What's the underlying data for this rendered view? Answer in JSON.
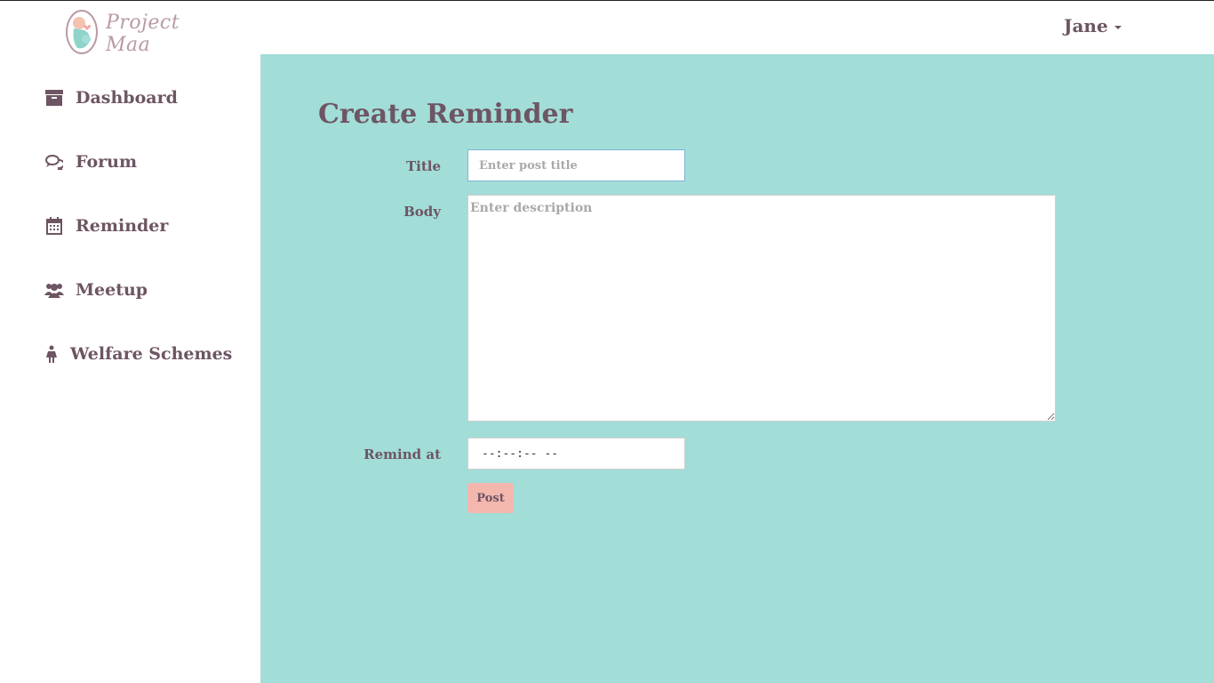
{
  "header": {
    "logo_text": "Project Maa",
    "user_name": "Jane"
  },
  "sidebar": {
    "items": [
      {
        "label": "Dashboard",
        "icon": "archive-box-icon"
      },
      {
        "label": "Forum",
        "icon": "chat-bubbles-icon"
      },
      {
        "label": "Reminder",
        "icon": "calendar-icon"
      },
      {
        "label": "Meetup",
        "icon": "users-group-icon"
      },
      {
        "label": "Welfare Schemes",
        "icon": "female-figure-icon"
      }
    ]
  },
  "main": {
    "title": "Create Reminder",
    "form": {
      "title_label": "Title",
      "title_placeholder": "Enter post title",
      "body_label": "Body",
      "body_placeholder": "Enter description",
      "remind_label": "Remind at",
      "remind_value": "--:--:--  --",
      "post_label": "Post"
    }
  },
  "colors": {
    "accent_bg": "#a2ddd8",
    "text": "#6e5563",
    "button_bg": "#f4b7ae"
  }
}
